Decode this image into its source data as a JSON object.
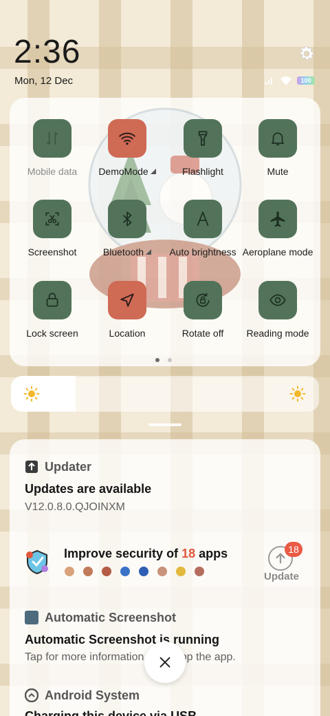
{
  "status": {
    "time": "2:36",
    "date": "Mon, 12 Dec",
    "battery": "100"
  },
  "quick_settings": {
    "tiles": [
      {
        "label": "Mobile data",
        "icon": "mobile-data-icon",
        "active": false,
        "disabled": true
      },
      {
        "label": "DemoMode",
        "icon": "wifi-icon",
        "active": true,
        "has_menu": true
      },
      {
        "label": "Flashlight",
        "icon": "flashlight-icon",
        "active": false
      },
      {
        "label": "Mute",
        "icon": "bell-icon",
        "active": false
      },
      {
        "label": "Screenshot",
        "icon": "screenshot-icon",
        "active": false
      },
      {
        "label": "Bluetooth",
        "icon": "bluetooth-icon",
        "active": false,
        "has_menu": true
      },
      {
        "label": "Auto brightness",
        "icon": "auto-brightness-icon",
        "active": false
      },
      {
        "label": "Aeroplane mode",
        "icon": "airplane-icon",
        "active": false
      },
      {
        "label": "Lock screen",
        "icon": "lock-icon",
        "active": false
      },
      {
        "label": "Location",
        "icon": "location-icon",
        "active": true
      },
      {
        "label": "Rotate off",
        "icon": "rotate-lock-icon",
        "active": false
      },
      {
        "label": "Reading mode",
        "icon": "eye-icon",
        "active": false
      }
    ],
    "page_count": 2,
    "current_page": 1
  },
  "brightness": {
    "level": 0.21
  },
  "notifications": {
    "updater": {
      "app": "Updater",
      "title": "Updates are available",
      "text": "V12.0.8.0.QJOINXM"
    },
    "security": {
      "title_prefix": "Improve security of ",
      "count": "18",
      "title_suffix": " apps",
      "badge": "18",
      "button_label": "Update"
    },
    "screenshot": {
      "app": "Automatic Screenshot",
      "title": "Automatic Screenshot is running",
      "text": "Tap for more information or to stop the app."
    },
    "android": {
      "app": "Android System",
      "title": "Charging this device via USB"
    }
  },
  "colors": {
    "tile_off": "#52735a",
    "tile_on": "#cf6a55",
    "badge": "#ea5a45"
  }
}
